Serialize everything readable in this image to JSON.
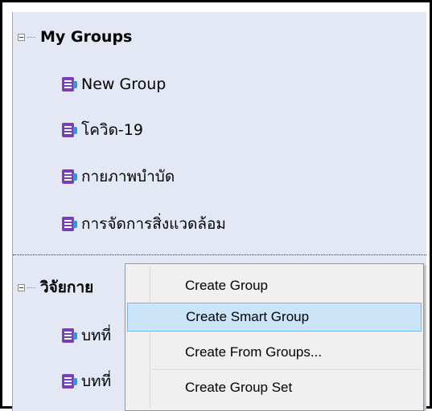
{
  "tree": {
    "groups": [
      {
        "label": "My Groups",
        "children": [
          "New Group",
          "โควิด-19",
          "กายภาพบำบัด",
          "การจัดการสิ่งแวดล้อม"
        ]
      },
      {
        "label": "วิจัยกาย",
        "children": [
          "บทที่",
          "บทที่"
        ]
      }
    ]
  },
  "context_menu": {
    "items": [
      "Create Group",
      "Create Smart Group",
      "Create From Groups...",
      "Create Group Set"
    ],
    "highlighted": "Create Smart Group"
  },
  "colors": {
    "panel_bg": "#e3e8f4",
    "icon_purple": "#7a3fb8",
    "icon_blue": "#2b9bd6",
    "menu_bg": "#f0f0f0",
    "menu_highlight": "#cce4f7"
  }
}
